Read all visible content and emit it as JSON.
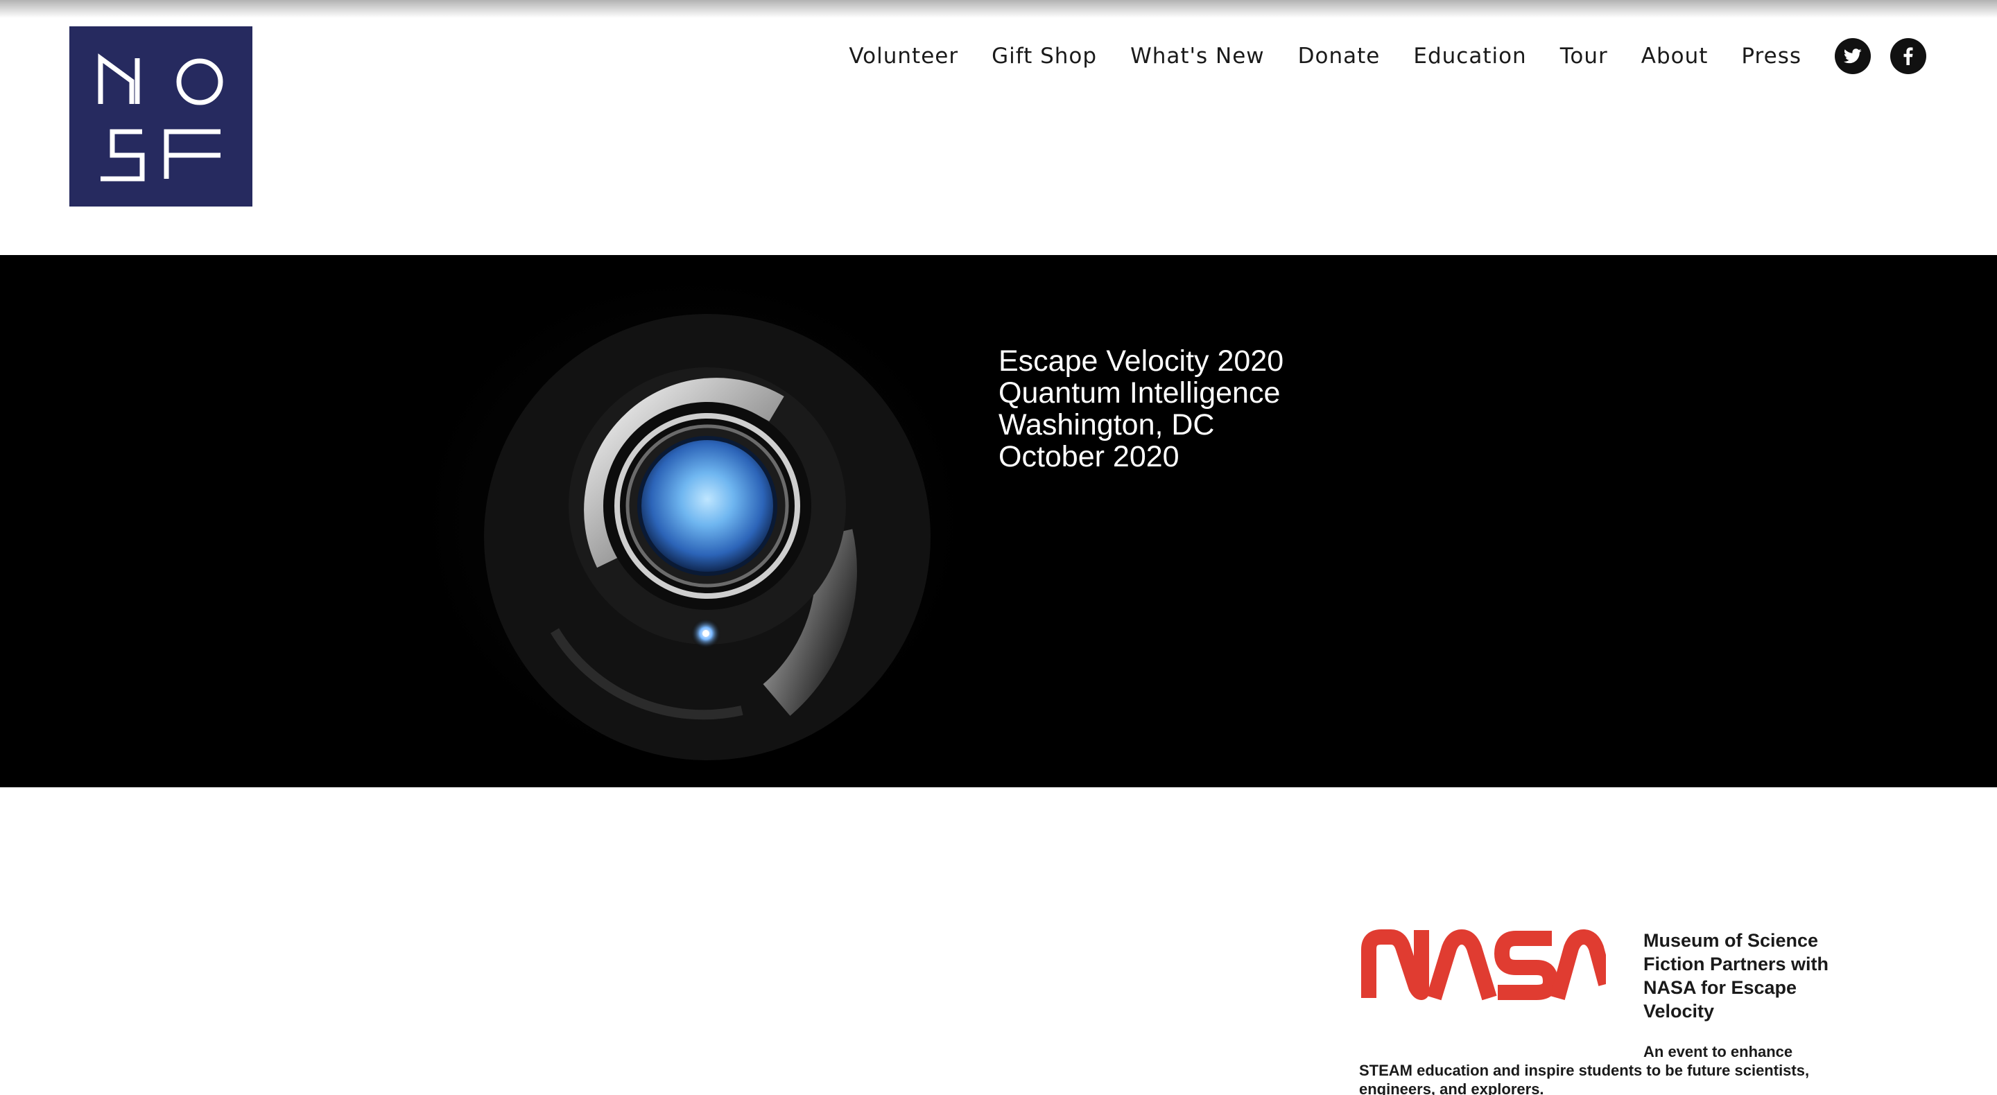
{
  "site": {
    "logo_text": "MOSF",
    "logo_bg": "#262a5f"
  },
  "nav": {
    "items": [
      {
        "label": "Volunteer"
      },
      {
        "label": "Gift Shop"
      },
      {
        "label": "What's New"
      },
      {
        "label": "Donate"
      },
      {
        "label": "Education"
      },
      {
        "label": "Tour"
      },
      {
        "label": "About"
      },
      {
        "label": "Press"
      }
    ],
    "social": [
      {
        "icon": "twitter-icon"
      },
      {
        "icon": "facebook-icon"
      }
    ]
  },
  "hero": {
    "lines": [
      "Escape Velocity 2020",
      "Quantum Intelligence",
      "Washington, DC",
      "October 2020"
    ]
  },
  "partner": {
    "logo_text": "NASA",
    "logo_color": "#e03c31",
    "title": "Museum of Science Fiction Partners with NASA for Escape Velocity",
    "description": "An event to enhance STEAM education and inspire students to be future scientists, engineers, and explorers."
  }
}
